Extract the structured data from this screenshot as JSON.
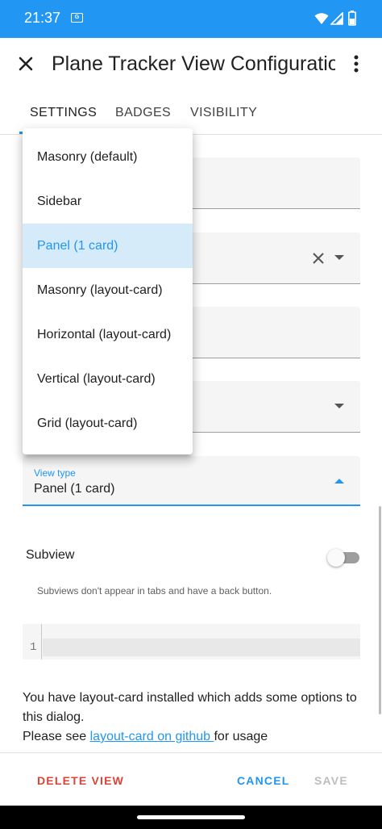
{
  "status_bar": {
    "time": "21:37",
    "notification_icon": "gs-icon",
    "icons": [
      "wifi-icon",
      "signal-icon",
      "battery-icon"
    ]
  },
  "toolbar": {
    "title": "Plane Tracker View Configuratio",
    "close_icon": "close-icon",
    "more_icon": "more-vert-icon"
  },
  "tabs": [
    {
      "label": "SETTINGS",
      "active": true
    },
    {
      "label": "BADGES",
      "active": false
    },
    {
      "label": "VISIBILITY",
      "active": false
    }
  ],
  "dropdown_menu": {
    "items": [
      {
        "label": "Masonry (default)",
        "selected": false
      },
      {
        "label": "Sidebar",
        "selected": false
      },
      {
        "label": "Panel (1 card)",
        "selected": true
      },
      {
        "label": "Masonry (layout-card)",
        "selected": false
      },
      {
        "label": "Horizontal (layout-card)",
        "selected": false
      },
      {
        "label": "Vertical (layout-card)",
        "selected": false
      },
      {
        "label": "Grid (layout-card)",
        "selected": false
      }
    ]
  },
  "view_type": {
    "label": "View type",
    "value": "Panel (1 card)"
  },
  "subview": {
    "label": "Subview",
    "enabled": false,
    "help": "Subviews don't appear in tabs and have a back button."
  },
  "editor": {
    "line_number": "1"
  },
  "info": {
    "line1": "You have layout-card installed which adds some options to this dialog.",
    "line2_prefix": "Please see ",
    "link": "layout-card on github ",
    "line2_suffix": "for usage"
  },
  "footer": {
    "delete_label": "DELETE VIEW",
    "cancel_label": "CANCEL",
    "save_label": "SAVE"
  },
  "colors": {
    "accent": "#2196f3",
    "danger": "#db4437",
    "disabled": "#bdbdbd",
    "selected_bg": "#d6ebfa"
  }
}
